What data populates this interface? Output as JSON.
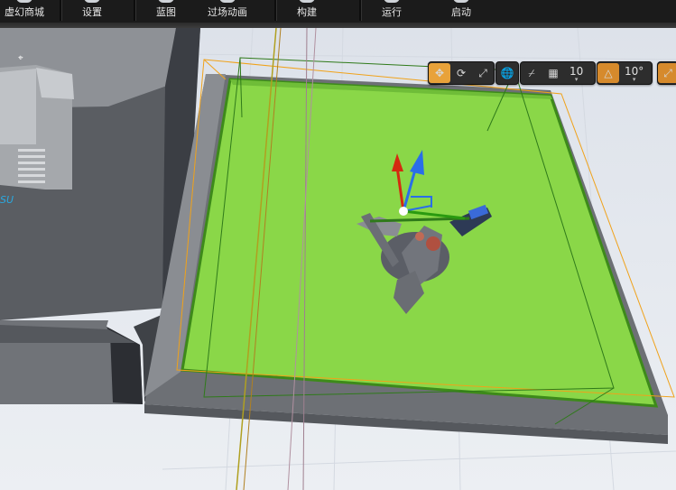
{
  "toolbar": {
    "items": [
      {
        "label": "虚幻商城"
      },
      {
        "label": "设置"
      },
      {
        "label": "蓝图"
      },
      {
        "label": "过场动画"
      },
      {
        "label": "构建"
      },
      {
        "label": "运行"
      },
      {
        "label": "启动"
      }
    ]
  },
  "viewport_toolbar": {
    "grid_snap_value": "10",
    "rotation_snap_value": "10°",
    "icons": [
      "translate-icon",
      "rotate-icon",
      "scale-icon",
      "world-space-icon",
      "surface-snap-icon",
      "grid-snap-icon",
      "rotation-snap-icon",
      "scale-snap-icon"
    ]
  },
  "scene": {
    "floor_color": "#8ad748",
    "platform_color": "#6c6e72",
    "selection_outline": "#f0a21a"
  }
}
